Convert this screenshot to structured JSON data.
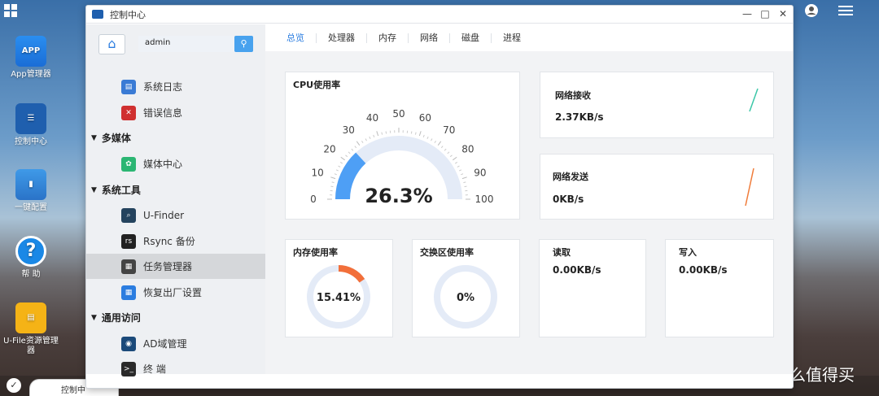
{
  "desktop": {
    "icons": [
      {
        "label": "App管理器",
        "glyph": "APP"
      },
      {
        "label": "控制中心",
        "glyph": "☰"
      },
      {
        "label": "一键配置",
        "glyph": "▮"
      },
      {
        "label": "帮 助",
        "glyph": "?"
      },
      {
        "label": "U-File资源管理器",
        "glyph": "▤"
      }
    ],
    "taskbar_tab": "控制中",
    "watermark": "什么值得买",
    "watermark_logo": "值"
  },
  "window": {
    "title": "控制中心",
    "controls": {
      "minimize": "—",
      "maximize": "□",
      "close": "✕"
    }
  },
  "sidebar": {
    "home_glyph": "⌂",
    "search_value": "admin",
    "search_glyph": "⚲",
    "items": [
      {
        "type": "sub",
        "label": "系统日志",
        "icon": "log-icon",
        "color": "#3a7bd5",
        "glyph": "▤"
      },
      {
        "type": "sub",
        "label": "错误信息",
        "icon": "error-icon",
        "color": "#d03030",
        "glyph": "✕"
      },
      {
        "type": "group",
        "label": "多媒体"
      },
      {
        "type": "sub",
        "label": "媒体中心",
        "icon": "media-icon",
        "color": "#2bb673",
        "glyph": "✿"
      },
      {
        "type": "group",
        "label": "系统工具"
      },
      {
        "type": "sub",
        "label": "U-Finder",
        "icon": "finder-icon",
        "color": "#24435e",
        "glyph": "⌕"
      },
      {
        "type": "sub",
        "label": "Rsync 备份",
        "icon": "rsync-icon",
        "color": "#222",
        "glyph": "rs"
      },
      {
        "type": "sub",
        "label": "任务管理器",
        "icon": "task-manager-icon",
        "color": "#444",
        "glyph": "▦",
        "active": true
      },
      {
        "type": "sub",
        "label": "恢复出厂设置",
        "icon": "reset-icon",
        "color": "#2b7de0",
        "glyph": "▦"
      },
      {
        "type": "group",
        "label": "通用访问"
      },
      {
        "type": "sub",
        "label": "AD域管理",
        "icon": "ad-domain-icon",
        "color": "#1b4a7a",
        "glyph": "◉"
      },
      {
        "type": "sub",
        "label": "终 端",
        "icon": "terminal-icon",
        "color": "#2a2a2a",
        "glyph": ">_"
      }
    ],
    "caret_glyph": "▼"
  },
  "tabs": [
    "总览",
    "处理器",
    "内存",
    "网络",
    "磁盘",
    "进程"
  ],
  "active_tab": 0,
  "cpu": {
    "title": "CPU使用率",
    "value": 26.3,
    "value_text": "26.3%",
    "ticks": [
      "0",
      "10",
      "20",
      "30",
      "40",
      "50",
      "60",
      "70",
      "80",
      "90",
      "100"
    ],
    "color": "#4e9ff5",
    "track_color": "#e4ebf7"
  },
  "net_recv": {
    "title": "网络接收",
    "value": "2.37KB/s",
    "color": "#3cc7a8"
  },
  "net_send": {
    "title": "网络发送",
    "value": "0KB/s",
    "color": "#f07c3a"
  },
  "memory": {
    "title": "内存使用率",
    "value": 15.41,
    "value_text": "15.41%",
    "color": "#f26f3a"
  },
  "swap": {
    "title": "交换区使用率",
    "value": 0,
    "value_text": "0%"
  },
  "read": {
    "title": "读取",
    "value": "0.00KB/s"
  },
  "write": {
    "title": "写入",
    "value": "0.00KB/s"
  }
}
